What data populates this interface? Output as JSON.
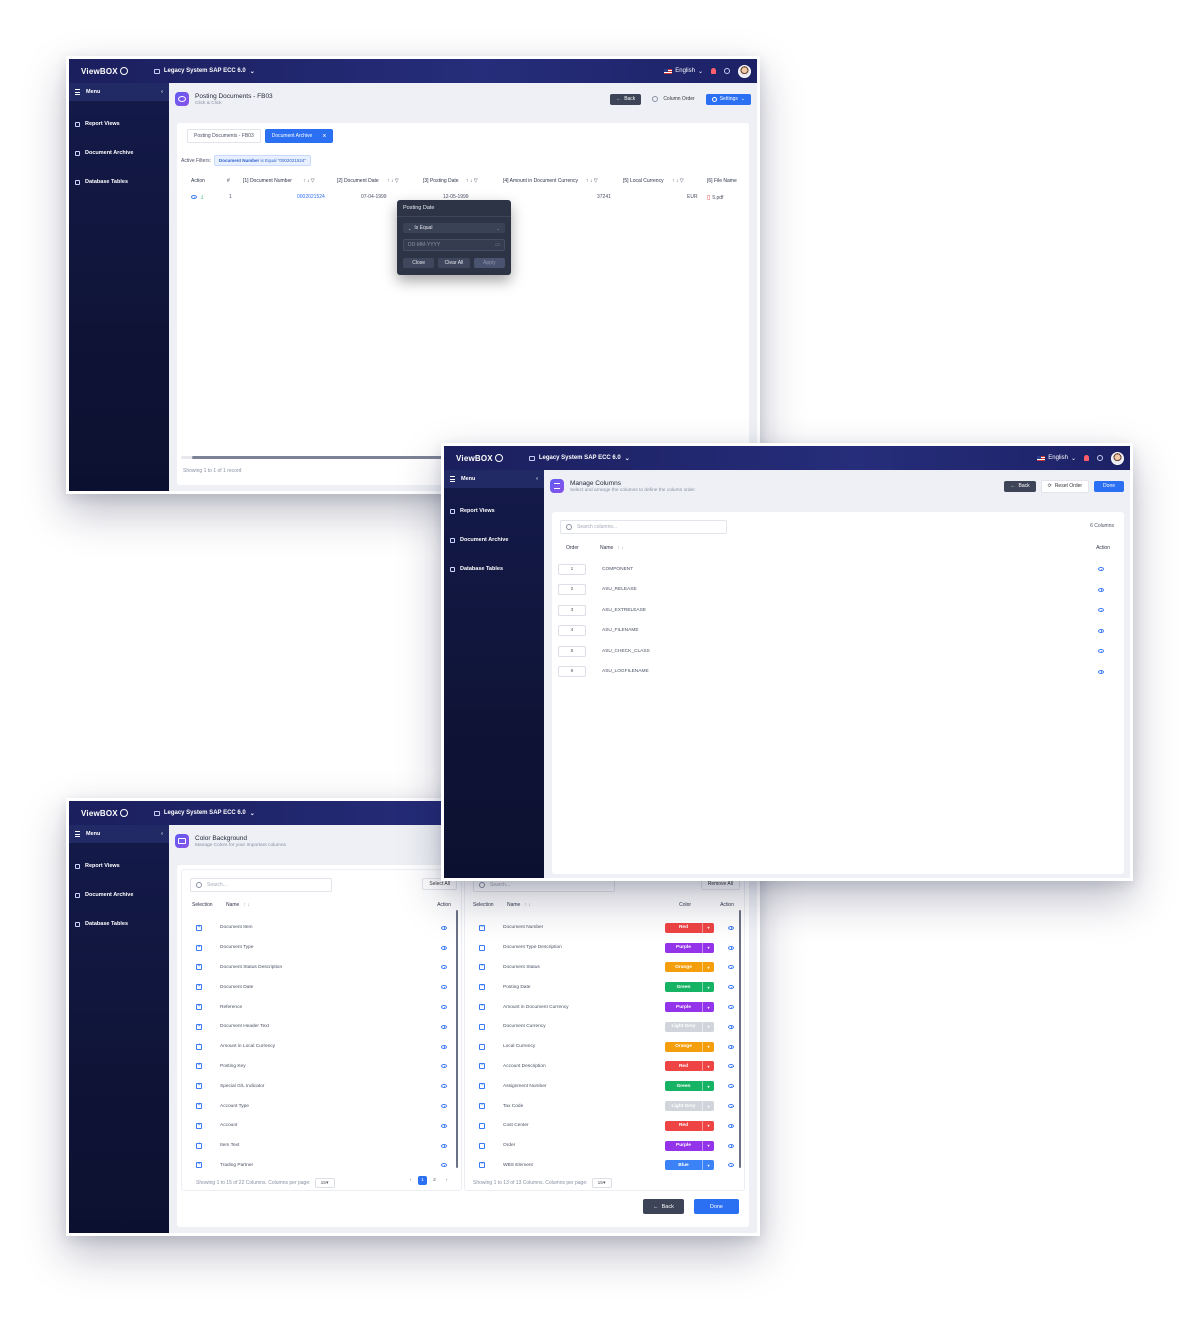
{
  "app": {
    "brand": "ViewBOX",
    "system": "Legacy System SAP ECC 6.0",
    "language": "English",
    "sidebar": {
      "menu_label": "Menu",
      "items": [
        {
          "label": "Report Views",
          "icon": "chart-icon"
        },
        {
          "label": "Document Archive",
          "icon": "archive-icon"
        },
        {
          "label": "Database Tables",
          "icon": "database-icon"
        }
      ]
    }
  },
  "screen1": {
    "title": "Posting Documents - FB03",
    "subtitle": "Click & Click",
    "back_label": "Back",
    "column_order_label": "Column Order",
    "settings_label": "Settings",
    "tabs": [
      {
        "label": "Posting Documents - FB03",
        "active": false
      },
      {
        "label": "Document Archive",
        "active": true
      }
    ],
    "active_filters_label": "Active Filters:",
    "filter_chip_field": "Document Number",
    "filter_chip_rest": "is Equal \"0002021524\"",
    "columns": [
      "Action",
      "#",
      "[1] Document Number",
      "[2] Document Date",
      "[3] Posting Date",
      "[4] Amount in Document Currency",
      "[5] Local Currency",
      "[6] File Name"
    ],
    "rows": [
      {
        "num": "1",
        "doc_number": "0002021524",
        "doc_date": "07-04-1999",
        "posting_date": "12-05-1999",
        "amount": "37241",
        "currency": "EUR",
        "file": "5.pdf"
      }
    ],
    "popover": {
      "title": "Posting Date",
      "operator": "Is Equal",
      "date_placeholder": "DD-MM-YYYY",
      "close_label": "Close",
      "clear_label": "Clear All",
      "apply_label": "Apply"
    },
    "footer": "Showing 1 to 1 of 1 record"
  },
  "screen2": {
    "title": "Manage Columns",
    "subtitle": "Select and arrange the columns to define the column order.",
    "back_label": "Back",
    "reset_label": "Reset Order",
    "done_label": "Done",
    "search_placeholder": "Search columns...",
    "count_label": "6 Columns",
    "headers": {
      "order": "Order",
      "name": "Name",
      "action": "Action"
    },
    "rows": [
      {
        "order": "1",
        "name": "COMPONENT"
      },
      {
        "order": "2",
        "name": "ASU_RELEASE"
      },
      {
        "order": "3",
        "name": "ASU_EXTRELEASE"
      },
      {
        "order": "4",
        "name": "ASU_FILENAME"
      },
      {
        "order": "5",
        "name": "ASU_CHECK_CLASS"
      },
      {
        "order": "6",
        "name": "ASU_LOGFILENAME"
      }
    ]
  },
  "screen3": {
    "title": "Color Background",
    "subtitle": "Manage Colors for your Important columns",
    "left": {
      "search_placeholder": "Search...",
      "select_all_label": "Select All",
      "headers": {
        "selection": "Selection",
        "name": "Name",
        "action": "Action"
      },
      "rows": [
        "Document Item",
        "Document Type",
        "Document Status Description",
        "Document Date",
        "Reference",
        "Document Header Text",
        "Amount in Local Currency",
        "Posting Key",
        "Special G/L Indicator",
        "Account Type",
        "Account",
        "Item Text",
        "Trading Partner"
      ],
      "footer": "Showing 1 to 15 of 22 Columns. Columns per page:",
      "per_page": "15",
      "pages": [
        "1",
        "2"
      ]
    },
    "right": {
      "search_placeholder": "Search...",
      "remove_all_label": "Remove All",
      "headers": {
        "selection": "Selection",
        "name": "Name",
        "color": "Color",
        "action": "Action"
      },
      "rows": [
        {
          "name": "Document Number",
          "color": "Red"
        },
        {
          "name": "Document Type Description",
          "color": "Purple"
        },
        {
          "name": "Document Status",
          "color": "Orange"
        },
        {
          "name": "Posting Date",
          "color": "Green"
        },
        {
          "name": "Amount in Document Currency",
          "color": "Purple"
        },
        {
          "name": "Document Currency",
          "color": "Light Grey"
        },
        {
          "name": "Local Currency",
          "color": "Orange"
        },
        {
          "name": "Account Description",
          "color": "Red"
        },
        {
          "name": "Assignment Number",
          "color": "Green"
        },
        {
          "name": "Tax Code",
          "color": "Light Grey"
        },
        {
          "name": "Cost Center",
          "color": "Red"
        },
        {
          "name": "Order",
          "color": "Purple"
        },
        {
          "name": "WBS Element",
          "color": "Blue"
        }
      ],
      "footer": "Showing 1 to 13 of 13 Columns. Columns per page:",
      "per_page": "15"
    },
    "back_label": "Back",
    "done_label": "Done"
  },
  "colors": {
    "Red": "#ef4444",
    "Purple": "#9333ea",
    "Orange": "#f59e0b",
    "Green": "#16b364",
    "Light Grey": "#d1d5db",
    "Blue": "#3b82f6",
    "accent": "#2b6ff2"
  }
}
